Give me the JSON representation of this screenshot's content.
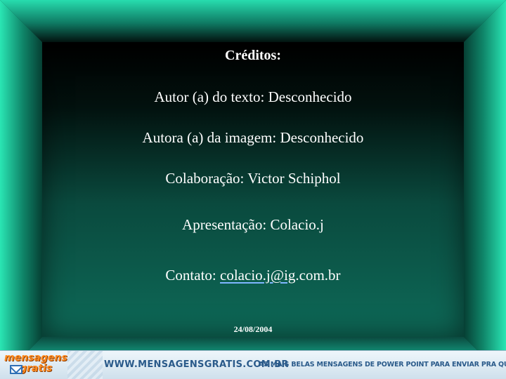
{
  "slide": {
    "title": "Créditos:",
    "author_text": "Autor (a) do texto: Desconhecido",
    "author_image": "Autora (a) da imagem: Desconhecido",
    "collaboration": "Colaboração: Victor Schiphol",
    "presentation": "Apresentação: Colacio.j",
    "contact_label": "Contato: ",
    "contact_email_link": "colacio.j@ig",
    "contact_email_rest": ".com.br",
    "date": "24/08/2004"
  },
  "banner": {
    "logo_top": "mensagens",
    "logo_bottom": "gratis",
    "url": "WWW.MENSAGENSGRATIS.COM.BR",
    "tagline": "AS MAIS BELAS MENSAGENS DE POWER POINT PARA ENVIAR PRA QUEM VOCÊ GOSTA."
  },
  "colors": {
    "frame_edge": "#2ae6b4",
    "text": "#ffffff",
    "banner_text": "#2a5a8a",
    "logo": "#ff8a1f"
  }
}
